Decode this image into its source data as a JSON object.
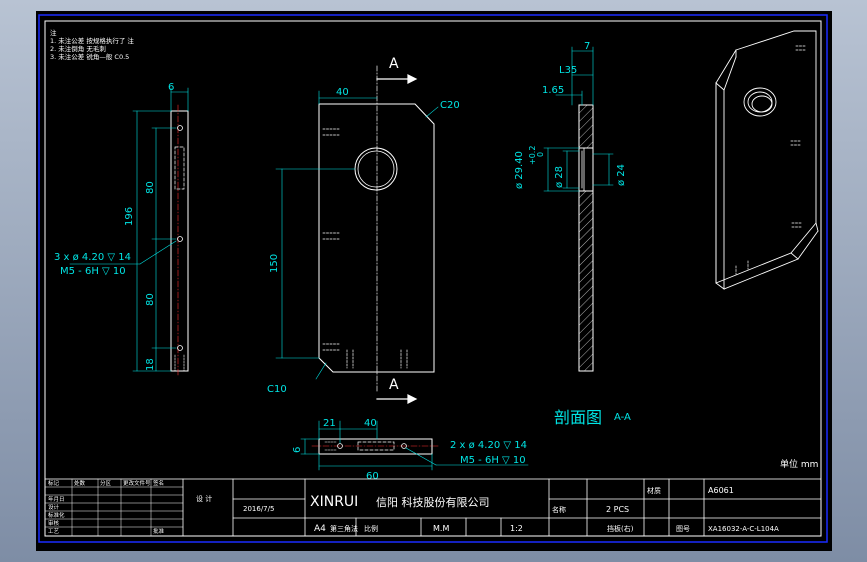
{
  "notes": {
    "heading": "注",
    "lines": [
      "1. 未注公差 按规格执行了 注",
      "2. 未注倒角 无毛刺",
      "3. 未注公差 锐角—般 C0.5"
    ]
  },
  "section_marks": {
    "upper": "A",
    "lower": "A"
  },
  "side_view": {
    "dims": [
      "6",
      "196",
      "80",
      "80",
      "18"
    ],
    "hole_callout_1": "3 x ø  4.20 ▽ 14",
    "hole_callout_2": "M5 - 6H ▽ 10"
  },
  "front_view": {
    "dims": [
      "40",
      "150"
    ],
    "chamfer_top": "C20",
    "chamfer_bottom": "C10"
  },
  "section_view": {
    "dims": [
      "7",
      "L35",
      "1.65",
      "ø 29.40",
      "+0.2",
      "0",
      "ø 28",
      "ø 24"
    ],
    "caption": "剖面图",
    "caption_suffix": "A-A"
  },
  "bottom_view": {
    "dims": [
      "21",
      "40",
      "6",
      "60"
    ],
    "hole_callout_1": "2 x ø  4.20 ▽ 14",
    "hole_callout_2": "M5 - 6H ▽ 10"
  },
  "roughness_note": "单位 mm",
  "title_block": {
    "company_latin": "XINRUI",
    "company_cn": "信阳 科技股份有限公司",
    "date": "2016/7/5",
    "sheet_size": "A4",
    "projection": "第三角法",
    "scale_label": "比例",
    "scale": "1:2",
    "unit": "M.M",
    "material_label": "材质",
    "material": "A6061",
    "quantity": "2 PCS",
    "name_label": "名称",
    "part_name": "挡板(右)",
    "drawing_no_label": "图号",
    "drawing_number": "XA16032-A-C-L104A",
    "drawn_by": "设 计",
    "left_cells": [
      "标记",
      "处数",
      "分区",
      "更改文件号",
      "签名",
      "年月日",
      "设计",
      "标准化",
      "审核",
      "工艺",
      "批准"
    ]
  }
}
